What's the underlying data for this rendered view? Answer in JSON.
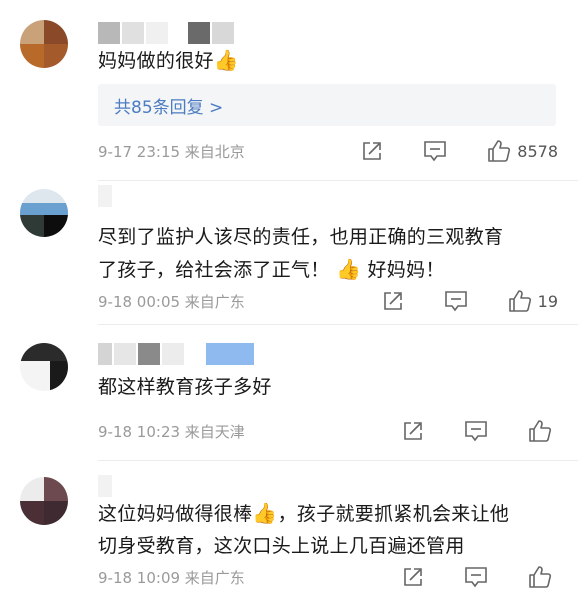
{
  "comments": [
    {
      "text": "妈妈做的很好",
      "emoji": "👍",
      "replies_link": "共85条回复 >",
      "meta": "9-17 23:15 来自北京",
      "likes": "8578"
    },
    {
      "text_line1": "尽到了监护人该尽的责任，也用正确的三观教育",
      "text_line2a": "了孩子，给社会添了正气！",
      "emoji": "👍",
      "text_line2b": "好妈妈！",
      "meta": "9-18 00:05 来自广东",
      "likes": "19"
    },
    {
      "text": "都这样教育孩子多好",
      "meta": "9-18 10:23 来自天津",
      "likes": ""
    },
    {
      "text_line1a": "这位妈妈做得很棒",
      "emoji": "👍",
      "text_line1b": "，孩子就要抓紧机会来让他",
      "text_line2": "切身受教育，这次口头上说上几百遍还管用",
      "meta": "9-18 10:09 来自广东",
      "likes": ""
    }
  ],
  "icons": [
    "share-icon",
    "comment-icon",
    "like-icon"
  ],
  "colors": {
    "link": "#4b7cc2",
    "meta": "#9a9a9a",
    "reply_bg": "#f3f5f7"
  }
}
